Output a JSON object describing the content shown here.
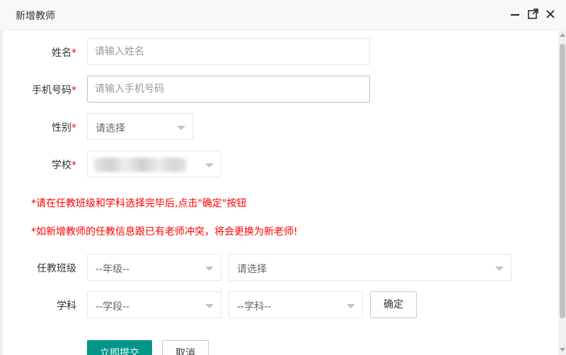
{
  "dialog": {
    "title": "新增教师",
    "minimize_icon": "minimize-icon",
    "maximize_icon": "maximize-icon",
    "close_icon": "close-icon"
  },
  "form": {
    "name": {
      "label": "姓名",
      "required_mark": "*",
      "placeholder": "请输入姓名",
      "value": ""
    },
    "phone": {
      "label": "手机号码",
      "required_mark": "*",
      "placeholder": "请输入手机号码",
      "value": ""
    },
    "gender": {
      "label": "性别",
      "required_mark": "*",
      "selected": "请选择"
    },
    "school": {
      "label": "学校",
      "required_mark": "*",
      "selected": ""
    },
    "notice_1": "*请在任教班级和学科选择完毕后,点击\"确定\"按钮",
    "notice_2": "*如新增教师的任教信息跟已有老师冲突，将会更换为新老师!",
    "class": {
      "label": "任教班级",
      "grade_selected": "--年级--",
      "class_selected": "请选择"
    },
    "subject": {
      "label": "学科",
      "stage_selected": "--学段--",
      "subject_selected": "--学科--",
      "confirm_label": "确定"
    },
    "submit_label": "立即提交",
    "cancel_label": "取消"
  },
  "colors": {
    "required": "#ff0000",
    "primary": "#009688"
  }
}
